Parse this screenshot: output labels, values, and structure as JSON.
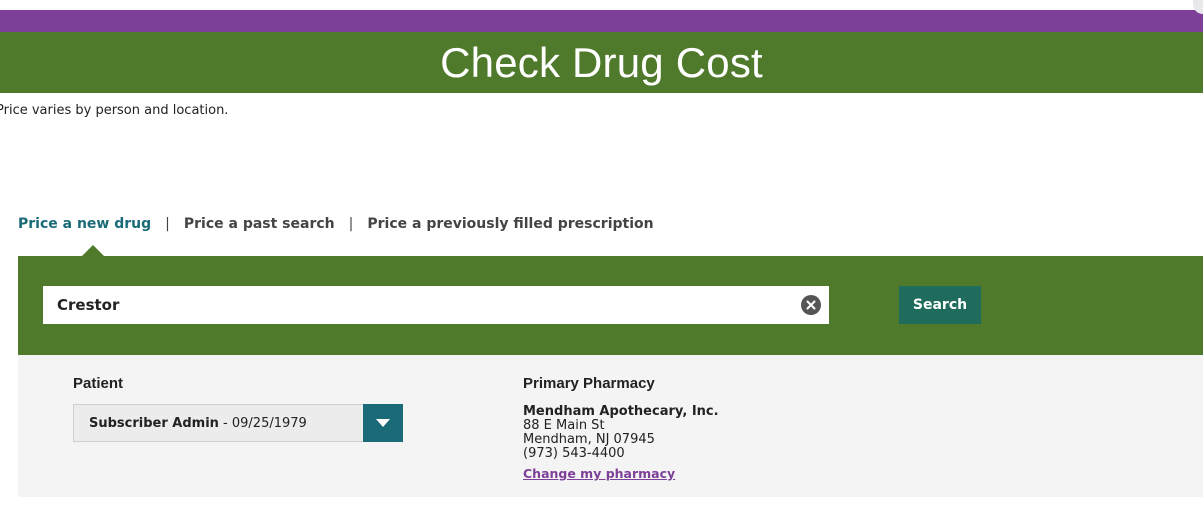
{
  "header": {
    "title": "Check Drug Cost",
    "accent_purple": "#7d3f98",
    "brand_green": "#507a2b"
  },
  "note": "Price varies by person and location.",
  "tabs": [
    {
      "label": "Price a new drug",
      "active": true
    },
    {
      "label": "Price a past search",
      "active": false
    },
    {
      "label": "Price a previously filled prescription",
      "active": false
    }
  ],
  "tab_separator": "|",
  "search": {
    "value": "Crestor",
    "clear_icon": "close-circle-icon",
    "button_label": "Search",
    "button_color": "#1f6b5c"
  },
  "patient": {
    "label": "Patient",
    "selected_name": "Subscriber Admin",
    "selected_dob": " - 09/25/1979",
    "dropdown_icon": "chevron-down-icon",
    "dropdown_color": "#1b6a78"
  },
  "pharmacy": {
    "label": "Primary Pharmacy",
    "name": "Mendham Apothecary, Inc.",
    "address_line1": "88 E Main St",
    "address_line2": "Mendham, NJ 07945",
    "phone": "(973) 543-4400",
    "change_link": "Change my pharmacy"
  }
}
